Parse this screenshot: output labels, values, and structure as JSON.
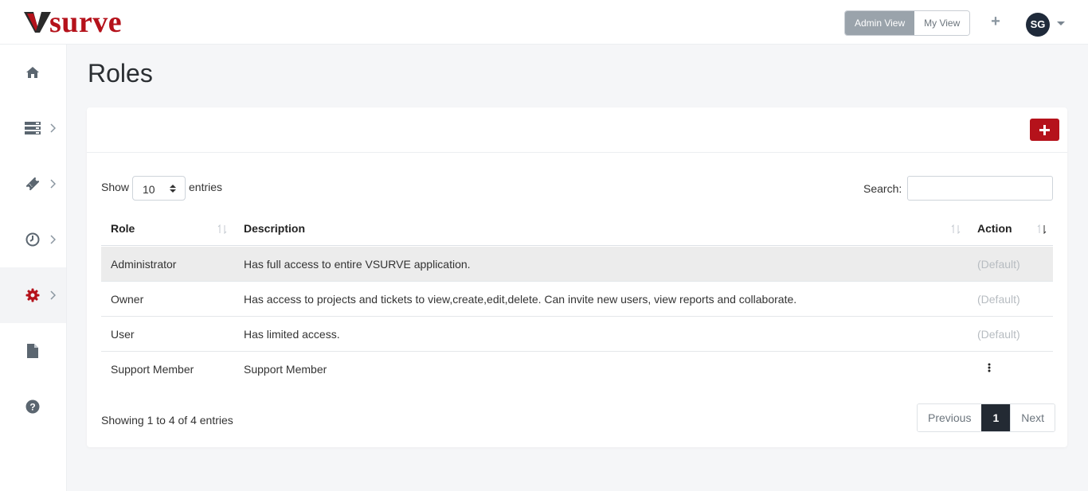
{
  "app": {
    "logo_text": "surve",
    "logo_v": "V"
  },
  "header": {
    "admin_view_label": "Admin View",
    "my_view_label": "My View",
    "add_icon": "plus-icon",
    "avatar_initials": "SG"
  },
  "sidebar": {
    "items": [
      {
        "icon": "home-icon",
        "has_chevron": false,
        "active": false
      },
      {
        "icon": "server-icon",
        "has_chevron": true,
        "active": false
      },
      {
        "icon": "ticket-icon",
        "has_chevron": true,
        "active": false
      },
      {
        "icon": "clock-icon",
        "has_chevron": true,
        "active": false
      },
      {
        "icon": "gear-icon",
        "has_chevron": true,
        "active": true
      },
      {
        "icon": "file-icon",
        "has_chevron": false,
        "active": false
      },
      {
        "icon": "help-icon",
        "has_chevron": false,
        "active": false
      }
    ]
  },
  "page": {
    "title": "Roles"
  },
  "table_controls": {
    "show_label": "Show",
    "entries_value": "10",
    "entries_label": "entries",
    "search_label": "Search:",
    "search_value": ""
  },
  "table": {
    "columns": [
      "Role",
      "Description",
      "Action"
    ],
    "rows": [
      {
        "role": "Administrator",
        "description": "Has full access to entire VSURVE application.",
        "action": "(Default)"
      },
      {
        "role": "Owner",
        "description": "Has access to projects and tickets to view,create,edit,delete. Can invite new users, view reports and collaborate.",
        "action": "(Default)"
      },
      {
        "role": "User",
        "description": "Has limited access.",
        "action": "(Default)"
      },
      {
        "role": "Support Member",
        "description": "Support Member",
        "action": ""
      }
    ]
  },
  "footer": {
    "showing_text": "Showing 1 to 4 of 4 entries",
    "previous_label": "Previous",
    "current_page": "1",
    "next_label": "Next"
  },
  "colors": {
    "brand_red": "#b5121b",
    "sidebar_icon": "#5b6670",
    "active_icon": "#b5121b",
    "pager_current": "#232a33"
  }
}
